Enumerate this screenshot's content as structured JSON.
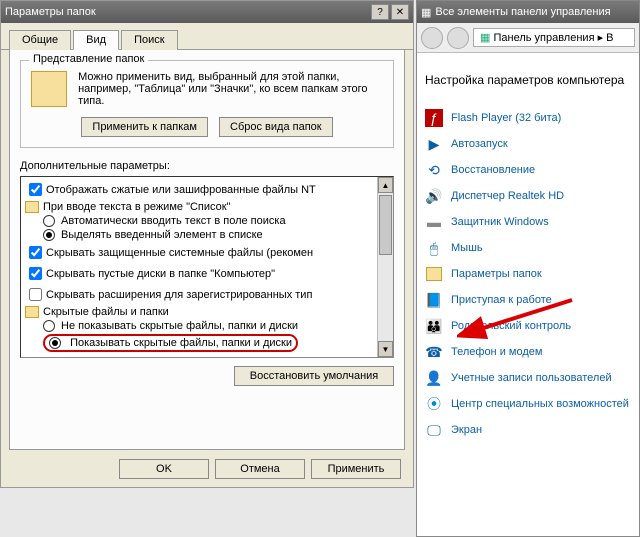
{
  "dialog": {
    "title": "Параметры папок",
    "tabs": {
      "general": "Общие",
      "view": "Вид",
      "search": "Поиск"
    },
    "group": {
      "title": "Представление папок",
      "desc": "Можно применить вид, выбранный для этой папки, например, \"Таблица\" или \"Значки\", ко всем папкам этого типа.",
      "apply": "Применить к папкам",
      "reset": "Сброс вида папок"
    },
    "extra_label": "Дополнительные параметры:",
    "tree": {
      "i0": "Отображать сжатые или зашифрованные файлы NT",
      "i1": "При вводе текста в режиме \"Список\"",
      "i1a": "Автоматически вводить текст в поле поиска",
      "i1b": "Выделять введенный элемент в списке",
      "i2": "Скрывать защищенные системные файлы (рекомен",
      "i3": "Скрывать пустые диски в папке \"Компьютер\"",
      "i4": "Скрывать расширения для зарегистрированных тип",
      "i5": "Скрытые файлы и папки",
      "i5a": "Не показывать скрытые файлы, папки и диски",
      "i5b": "Показывать скрытые файлы, папки и диски"
    },
    "restore": "Восстановить умолчания",
    "ok": "OK",
    "cancel": "Отмена",
    "apply_btn": "Применить"
  },
  "cp": {
    "title": "Все элементы панели управления",
    "breadcrumb": "Панель управления",
    "heading": "Настройка параметров компьютера",
    "items": {
      "flash": "Flash Player (32 бита)",
      "autoplay": "Автозапуск",
      "recovery": "Восстановление",
      "realtek": "Диспетчер Realtek HD",
      "defender": "Защитник Windows",
      "mouse": "Мышь",
      "folders": "Параметры папок",
      "getting": "Приступая к работе",
      "parental": "Родительский контроль",
      "phone": "Телефон и модем",
      "users": "Учетные записи пользователей",
      "access": "Центр специальных возможностей",
      "display": "Экран"
    }
  }
}
